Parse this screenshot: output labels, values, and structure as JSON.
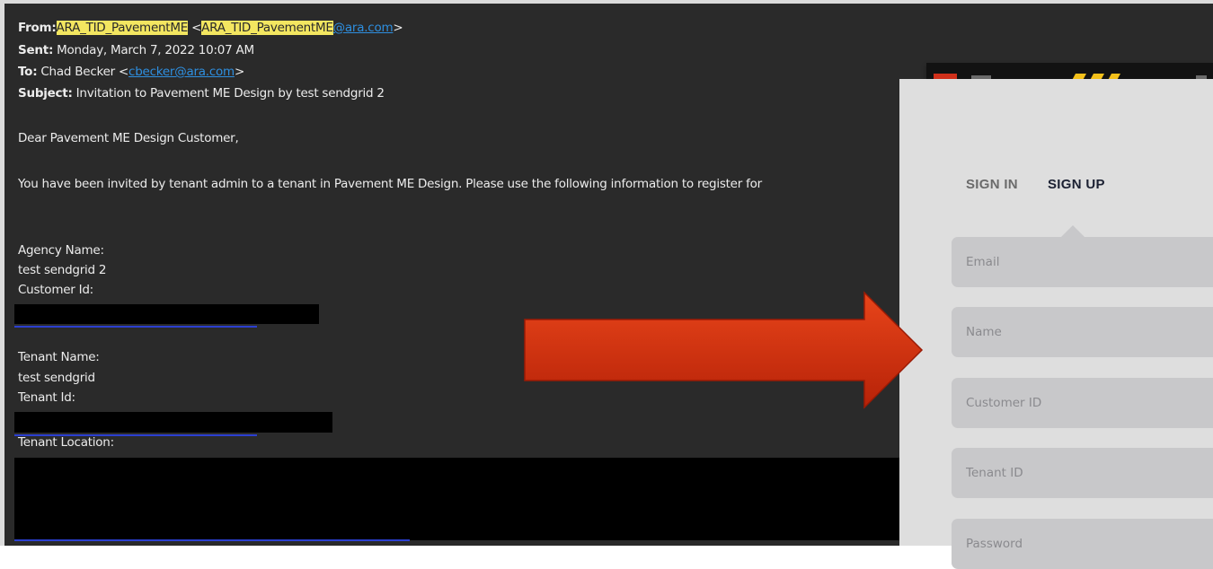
{
  "email": {
    "from_label": "From:",
    "from_name": "ARA_TID_PavementME",
    "from_addr_open": " <",
    "from_addr_local": "ARA_TID_PavementME",
    "from_addr_domain": "@ara.com",
    "from_addr_close": ">",
    "sent_label": "Sent:",
    "sent_value": " Monday, March 7, 2022 10:07 AM",
    "to_label": "To:",
    "to_name": " Chad Becker <",
    "to_addr": "cbecker@ara.com",
    "to_close": ">",
    "subject_label": "Subject:",
    "subject_value": " Invitation to Pavement ME Design by test sendgrid 2",
    "greeting": "Dear Pavement ME Design Customer,",
    "body": "You have been invited by tenant admin to a tenant in Pavement ME Design. Please use the following information to register for",
    "agency_label": "Agency Name:",
    "agency_value": "test sendgrid 2",
    "customer_id_label": "Customer Id:",
    "tenant_name_label": "Tenant Name:",
    "tenant_name_value": "test sendgrid",
    "tenant_id_label": "Tenant Id:",
    "tenant_location_label": "Tenant Location:"
  },
  "signup_panel": {
    "tabs": [
      "SIGN IN",
      "SIGN UP"
    ],
    "active_tab": "SIGN UP",
    "fields": [
      {
        "placeholder": "Email"
      },
      {
        "placeholder": "Name"
      },
      {
        "placeholder": "Customer ID"
      },
      {
        "placeholder": "Tenant ID"
      },
      {
        "placeholder": "Password"
      }
    ]
  },
  "colors": {
    "email_bg": "#2a2a2a",
    "highlight": "#f3e660",
    "link": "#2e8fe0",
    "arrow": "#d93a10",
    "panel_bg": "#dedede",
    "field_bg": "#c8c8ca",
    "active_tab": "#1c2133"
  },
  "icons": [
    "arrow-right-icon",
    "logo-stripes-icon"
  ]
}
